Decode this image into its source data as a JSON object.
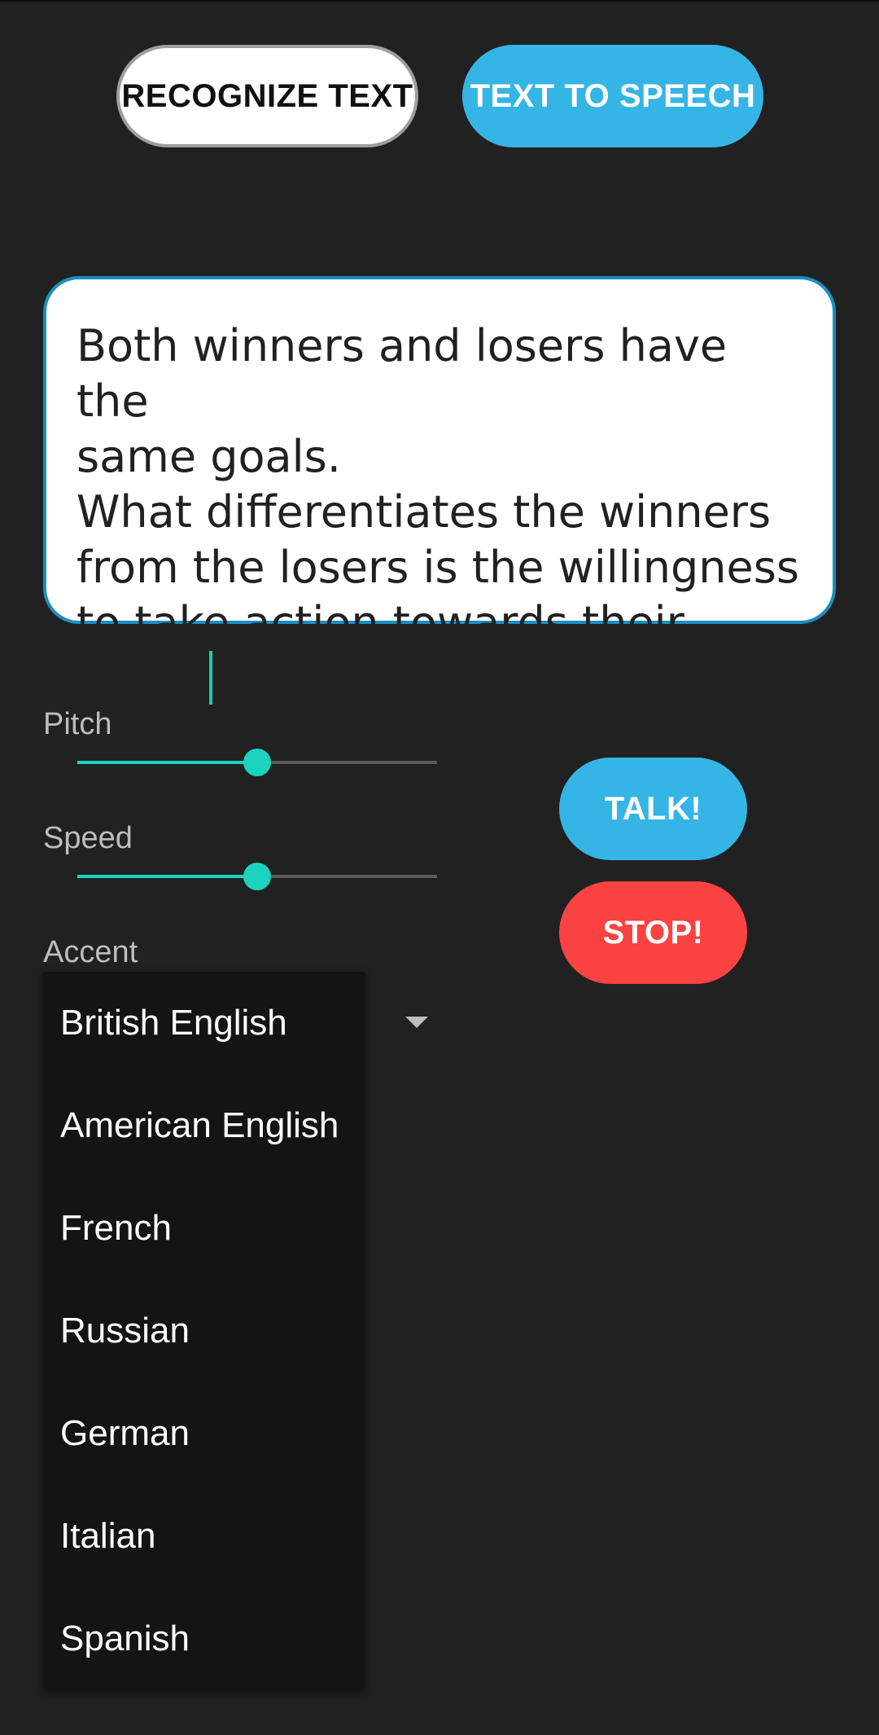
{
  "buttons": {
    "recognize_text": "RECOGNIZE TEXT",
    "text_to_speech": "TEXT TO SPEECH",
    "talk": "TALK!",
    "stop": "STOP!"
  },
  "text_input": {
    "value": "Both winners and losers have the\nsame goals.\nWhat differentiates the winners\nfrom the losers is the willingness\nto take action towards their goals."
  },
  "controls": {
    "pitch_label": "Pitch",
    "pitch_value": 0.5,
    "speed_label": "Speed",
    "speed_value": 0.5,
    "accent_label": "Accent"
  },
  "accent_options": [
    "British English",
    "American English",
    "French",
    "Russian",
    "German",
    "Italian",
    "Spanish"
  ],
  "colors": {
    "background": "#212121",
    "accent_blue": "#35b5e5",
    "stop_red": "#fb4242",
    "slider_teal": "#1cd3bf"
  },
  "icons": {
    "dropdown": "triangle-down-icon"
  }
}
